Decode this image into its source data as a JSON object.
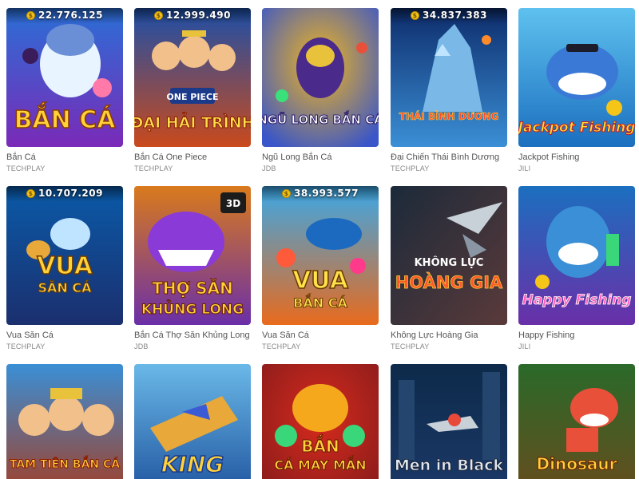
{
  "games": [
    {
      "title": "Bắn Cá",
      "provider": "TECHPLAY",
      "jackpot": "22.776.125",
      "logo": "BẮN CÁ",
      "bg1": "#2a6fd6",
      "bg2": "#7a2ab8",
      "logo_color": "#ffd23a"
    },
    {
      "title": "Bắn Cá One Piece",
      "provider": "TECHPLAY",
      "jackpot": "12.999.490",
      "logo": "ĐẠI HẢI TRÌNH",
      "bg1": "#1d4fa8",
      "bg2": "#c94a1c",
      "logo_color": "#ffe14a"
    },
    {
      "title": "Ngũ Long Bắn Cá",
      "provider": "JDB",
      "jackpot": "",
      "logo": "NGŨ LONG BẮN CÁ",
      "bg1": "#f1b51e",
      "bg2": "#3a56c8",
      "logo_color": "#ffffff"
    },
    {
      "title": "Đại Chiến Thái Bình Dương",
      "provider": "TECHPLAY",
      "jackpot": "34.837.383",
      "logo": "THÁI BÌNH DƯƠNG",
      "bg1": "#0d2c6b",
      "bg2": "#3b8fd6",
      "logo_color": "#ff4a2a"
    },
    {
      "title": "Jackpot Fishing",
      "provider": "JILI",
      "jackpot": "",
      "logo": "Jackpot Fishing",
      "bg1": "#5ec1ee",
      "bg2": "#1b6fbf",
      "logo_color": "#ffe03a"
    },
    {
      "title": "Vua Săn Cá",
      "provider": "TECHPLAY",
      "jackpot": "10.707.209",
      "logo": "VUA SĂN CÁ",
      "bg1": "#0a5aa8",
      "bg2": "#1b2f6e",
      "logo_color": "#ffd23a"
    },
    {
      "title": "Bắn Cá Thợ Săn Khủng Long",
      "provider": "JDB",
      "jackpot": "",
      "logo": "THỢ SĂN KHỦNG LONG",
      "bg1": "#d97a1c",
      "bg2": "#6a2fa8",
      "logo_color": "#ffd23a"
    },
    {
      "title": "Vua Săn Cá",
      "provider": "TECHPLAY",
      "jackpot": "38.993.577",
      "logo": "VUA BẮN CÁ",
      "bg1": "#3aa8e8",
      "bg2": "#e86a1c",
      "logo_color": "#ffe14a"
    },
    {
      "title": "Không Lực Hoàng Gia",
      "provider": "TECHPLAY",
      "jackpot": "",
      "logo": "HOÀNG GIA",
      "bg1": "#1c2a3a",
      "bg2": "#5a3a3a",
      "logo_color": "#ff5a2a"
    },
    {
      "title": "Happy Fishing",
      "provider": "JILI",
      "jackpot": "",
      "logo": "Happy Fishing",
      "bg1": "#1b6fbf",
      "bg2": "#6a2fa8",
      "logo_color": "#ff5ab8"
    },
    {
      "title": "",
      "provider": "",
      "jackpot": "",
      "logo": "TAM TIÊN BẮN CÁ",
      "bg1": "#3a8fd6",
      "bg2": "#a83a1c",
      "logo_color": "#ffd23a"
    },
    {
      "title": "",
      "provider": "",
      "jackpot": "",
      "logo": "KING",
      "bg1": "#6ab8e8",
      "bg2": "#1b4f9a",
      "logo_color": "#ffd23a"
    },
    {
      "title": "",
      "provider": "",
      "jackpot": "",
      "logo": "BẮN CÁ MAY MẮN",
      "bg1": "#d62a1c",
      "bg2": "#8a1c1c",
      "logo_color": "#ffd23a"
    },
    {
      "title": "",
      "provider": "",
      "jackpot": "",
      "logo": "Men in Black",
      "bg1": "#0d2a4a",
      "bg2": "#1c3a6a",
      "logo_color": "#e0e8f0"
    },
    {
      "title": "",
      "provider": "",
      "jackpot": "",
      "logo": "Dinosaur",
      "bg1": "#2a6a2a",
      "bg2": "#6a4a1c",
      "logo_color": "#ffd23a"
    }
  ]
}
